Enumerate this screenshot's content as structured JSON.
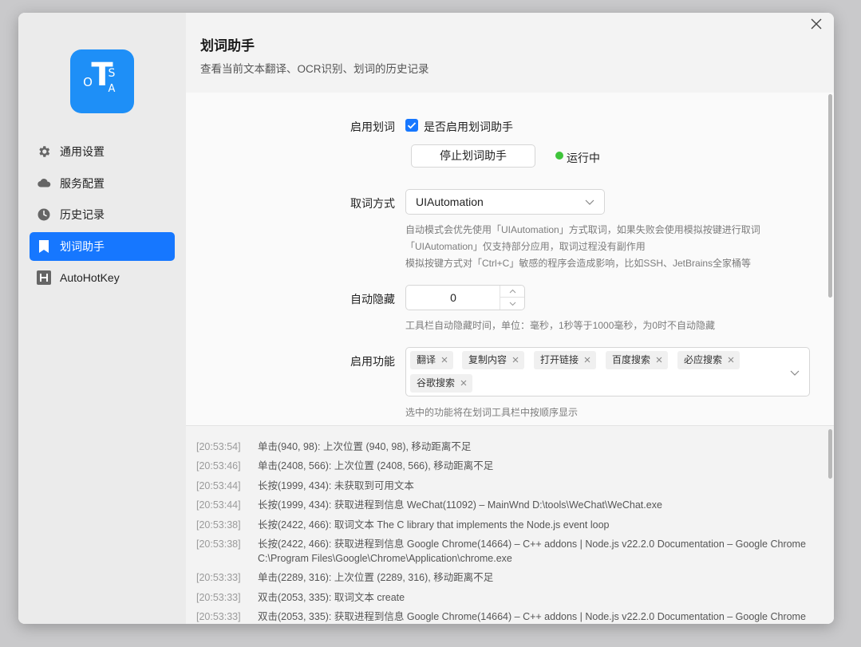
{
  "app": {
    "logo_letters": {
      "o": "O",
      "t": "T",
      "s": "S",
      "a": "A"
    }
  },
  "sidebar": {
    "items": [
      {
        "label": "通用设置",
        "icon": "gear-icon"
      },
      {
        "label": "服务配置",
        "icon": "cloud-icon"
      },
      {
        "label": "历史记录",
        "icon": "clock-icon"
      },
      {
        "label": "划词助手",
        "icon": "bookmark-icon",
        "active": true
      },
      {
        "label": "AutoHotKey",
        "icon": "autohotkey-icon"
      }
    ]
  },
  "header": {
    "title": "划词助手",
    "subtitle": "查看当前文本翻译、OCR识别、划词的历史记录"
  },
  "settings": {
    "enable": {
      "label": "启用划词",
      "checkbox_label": "是否启用划词助手",
      "checked": true,
      "stop_button": "停止划词助手",
      "status": "运行中",
      "status_color": "#3ec43a"
    },
    "method": {
      "label": "取词方式",
      "selected": "UIAutomation",
      "hints": [
        "自动模式会优先使用「UIAutomation」方式取词，如果失败会使用模拟按键进行取词",
        "「UIAutomation」仅支持部分应用，取词过程没有副作用",
        "模拟按键方式对「Ctrl+C」敏感的程序会造成影响，比如SSH、JetBrains全家桶等"
      ]
    },
    "autohide": {
      "label": "自动隐藏",
      "value": "0",
      "hint": "工具栏自动隐藏时间，单位：毫秒，1秒等于1000毫秒，为0时不自动隐藏"
    },
    "features": {
      "label": "启用功能",
      "tags": [
        "翻译",
        "复制内容",
        "打开链接",
        "百度搜索",
        "必应搜索",
        "谷歌搜索"
      ],
      "hint": "选中的功能将在划词工具栏中按顺序显示"
    }
  },
  "log": [
    {
      "time": "[20:53:54]",
      "msg": "单击(940, 98): 上次位置 (940, 98), 移动距离不足"
    },
    {
      "time": "[20:53:46]",
      "msg": "单击(2408, 566): 上次位置 (2408, 566), 移动距离不足"
    },
    {
      "time": "[20:53:44]",
      "msg": "长按(1999, 434): 未获取到可用文本"
    },
    {
      "time": "[20:53:44]",
      "msg": "长按(1999, 434): 获取进程到信息 WeChat(11092) – MainWnd D:\\tools\\WeChat\\WeChat.exe"
    },
    {
      "time": "[20:53:38]",
      "msg": "长按(2422, 466): 取词文本 The C library that implements the Node.js event loop"
    },
    {
      "time": "[20:53:38]",
      "msg": "长按(2422, 466): 获取进程到信息 Google Chrome(14664) – C++ addons | Node.js v22.2.0 Documentation – Google Chrome\nC:\\Program Files\\Google\\Chrome\\Application\\chrome.exe"
    },
    {
      "time": "[20:53:33]",
      "msg": "单击(2289, 316): 上次位置 (2289, 316), 移动距离不足"
    },
    {
      "time": "[20:53:33]",
      "msg": "双击(2053, 335): 取词文本 create"
    },
    {
      "time": "[20:53:33]",
      "msg": "双击(2053, 335): 获取进程到信息 Google Chrome(14664) – C++ addons | Node.js v22.2.0 Documentation – Google Chrome"
    }
  ]
}
